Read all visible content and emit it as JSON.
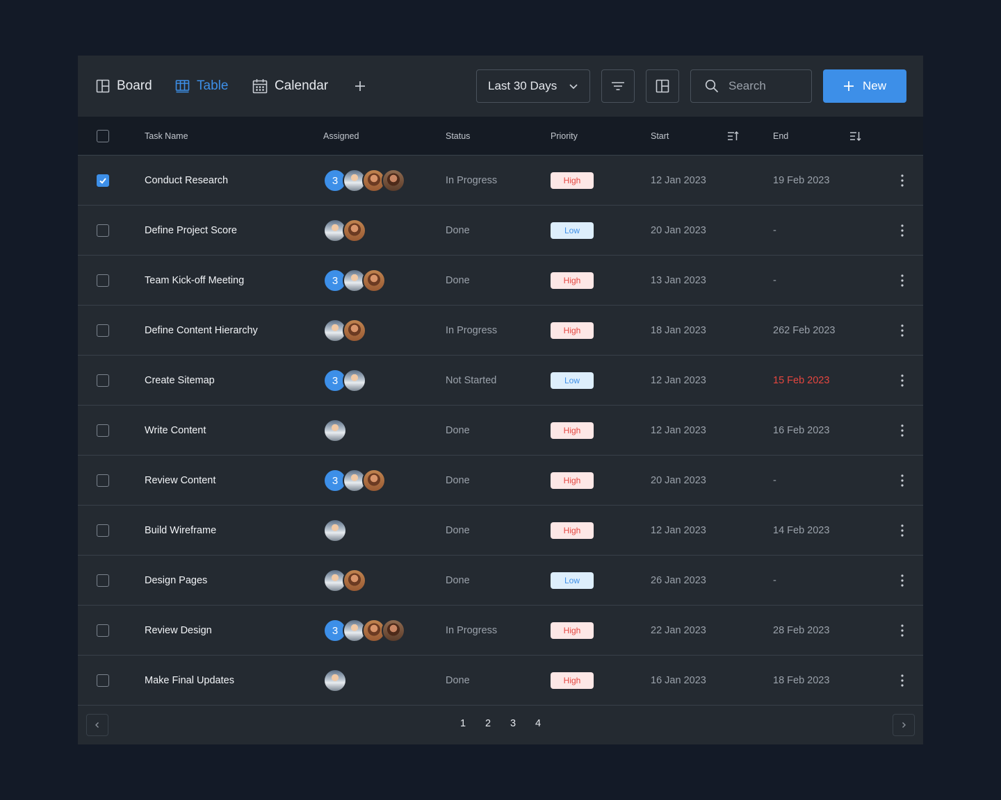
{
  "views": [
    {
      "label": "Board",
      "icon": "board-icon",
      "active": false
    },
    {
      "label": "Table",
      "icon": "table-icon",
      "active": true
    },
    {
      "label": "Calendar",
      "icon": "calendar-icon",
      "active": false
    }
  ],
  "toolbar": {
    "date_range": "Last 30 Days",
    "search_placeholder": "Search",
    "new_label": "New"
  },
  "columns": {
    "task": "Task Name",
    "assigned": "Assigned",
    "status": "Status",
    "priority": "Priority",
    "start": "Start",
    "end": "End"
  },
  "colors": {
    "accent": "#3d8fe8",
    "high_bg": "#fde7e6",
    "high_text": "#e5463f",
    "low_bg": "#ddeefc",
    "low_text": "#3d8fe8",
    "overdue": "#e5463f"
  },
  "rows": [
    {
      "checked": true,
      "task": "Conduct Research",
      "count": "3",
      "avatars": [
        "p1",
        "p2",
        "p3"
      ],
      "status": "In Progress",
      "priority": "High",
      "start": "12 Jan 2023",
      "end": "19 Feb 2023",
      "overdue": false
    },
    {
      "checked": false,
      "task": "Define Project Score",
      "count": "",
      "avatars": [
        "p1",
        "p2"
      ],
      "status": "Done",
      "priority": "Low",
      "start": "20 Jan 2023",
      "end": "-",
      "overdue": false
    },
    {
      "checked": false,
      "task": "Team Kick-off Meeting",
      "count": "3",
      "avatars": [
        "p1",
        "p2"
      ],
      "status": "Done",
      "priority": "High",
      "start": "13 Jan 2023",
      "end": "-",
      "overdue": false
    },
    {
      "checked": false,
      "task": "Define Content Hierarchy",
      "count": "",
      "avatars": [
        "p1",
        "p2"
      ],
      "status": "In Progress",
      "priority": "High",
      "start": "18 Jan 2023",
      "end": "262 Feb 2023",
      "overdue": false
    },
    {
      "checked": false,
      "task": "Create Sitemap",
      "count": "3",
      "avatars": [
        "p1"
      ],
      "status": "Not Started",
      "priority": "Low",
      "start": "12 Jan 2023",
      "end": "15 Feb 2023",
      "overdue": true
    },
    {
      "checked": false,
      "task": "Write Content",
      "count": "",
      "avatars": [
        "p1"
      ],
      "status": "Done",
      "priority": "High",
      "start": "12 Jan 2023",
      "end": "16 Feb 2023",
      "overdue": false
    },
    {
      "checked": false,
      "task": "Review Content",
      "count": "3",
      "avatars": [
        "p1",
        "p2"
      ],
      "status": "Done",
      "priority": "High",
      "start": "20 Jan 2023",
      "end": "-",
      "overdue": false
    },
    {
      "checked": false,
      "task": "Build Wireframe",
      "count": "",
      "avatars": [
        "p1"
      ],
      "status": "Done",
      "priority": "High",
      "start": "12 Jan 2023",
      "end": "14 Feb 2023",
      "overdue": false
    },
    {
      "checked": false,
      "task": "Design Pages",
      "count": "",
      "avatars": [
        "p1",
        "p2"
      ],
      "status": "Done",
      "priority": "Low",
      "start": "26 Jan 2023",
      "end": "-",
      "overdue": false
    },
    {
      "checked": false,
      "task": "Review Design",
      "count": "3",
      "avatars": [
        "p1",
        "p2",
        "p3"
      ],
      "status": "In Progress",
      "priority": "High",
      "start": "22 Jan 2023",
      "end": "28 Feb 2023",
      "overdue": false
    },
    {
      "checked": false,
      "task": "Make Final Updates",
      "count": "",
      "avatars": [
        "p1"
      ],
      "status": "Done",
      "priority": "High",
      "start": "16 Jan 2023",
      "end": "18 Feb 2023",
      "overdue": false
    }
  ],
  "pagination": {
    "pages": [
      "1",
      "2",
      "3",
      "4"
    ]
  }
}
